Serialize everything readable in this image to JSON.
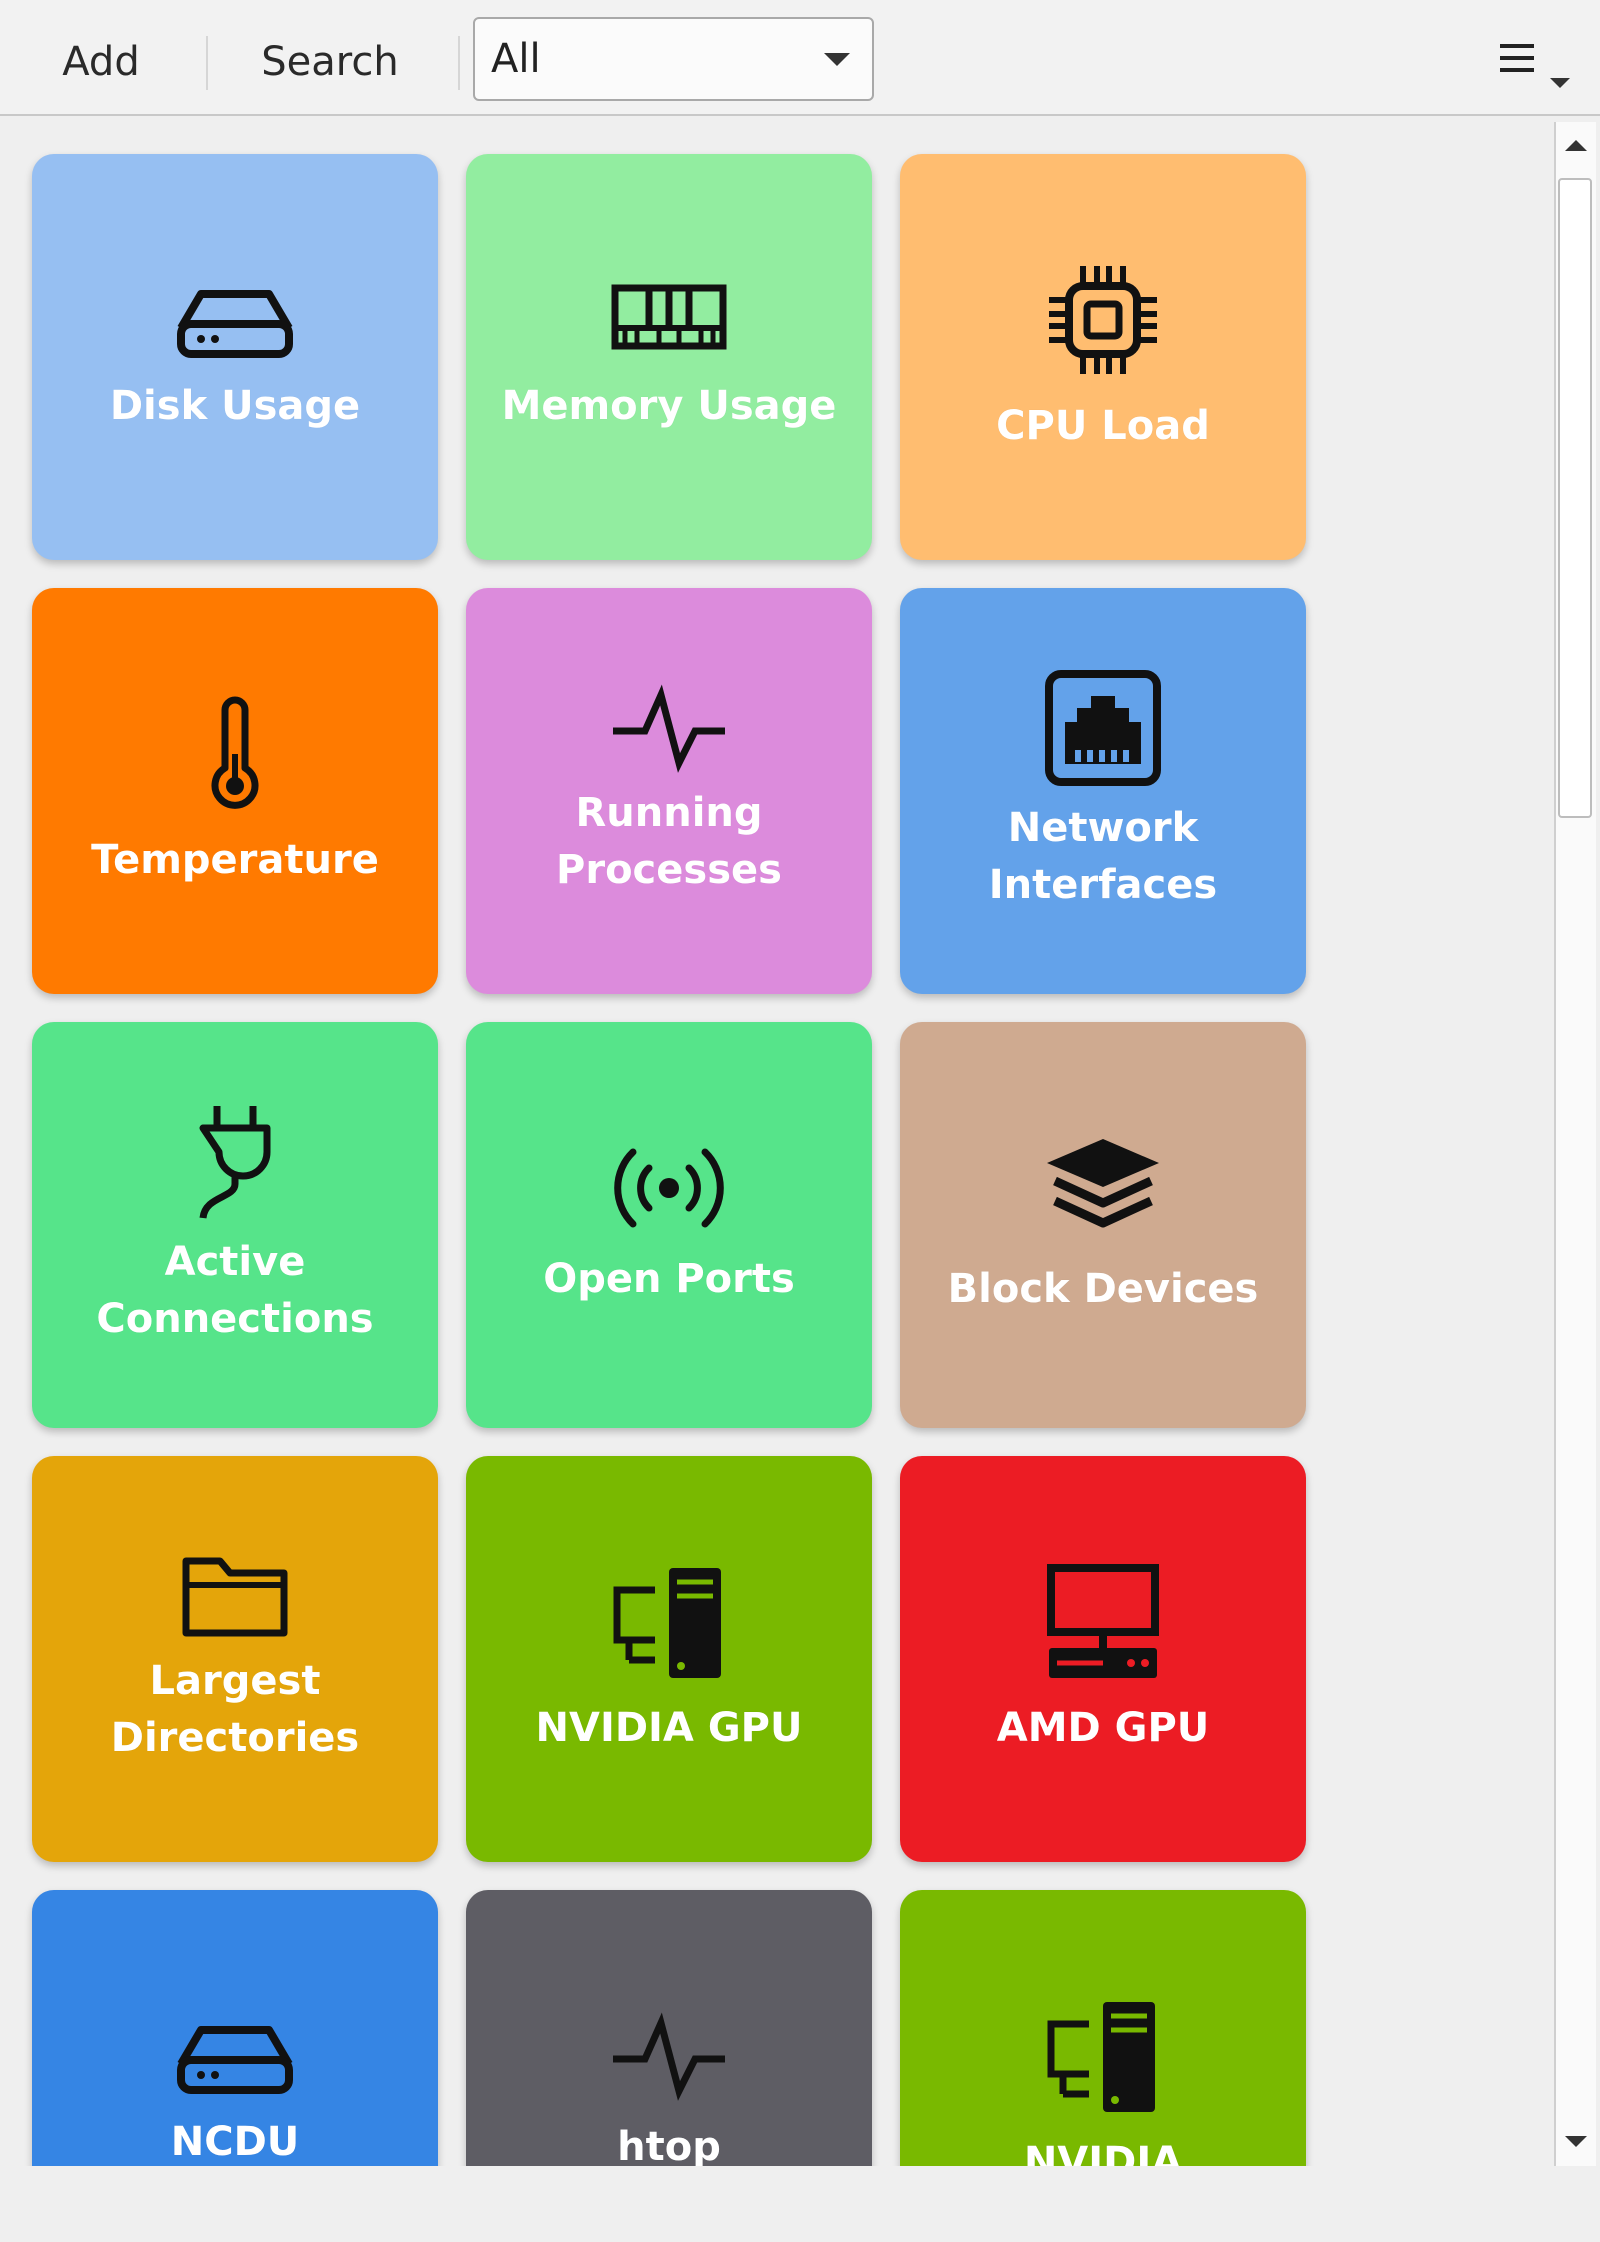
{
  "toolbar": {
    "add_label": "Add",
    "search_label": "Search",
    "filter_value": "All",
    "menu_icon": "hamburger-menu-icon"
  },
  "tiles": [
    {
      "label": "Disk Usage",
      "color": "#96bff2",
      "icon": "hard-drive-icon"
    },
    {
      "label": "Memory Usage",
      "color": "#92eda0",
      "icon": "memory-icon"
    },
    {
      "label": "CPU Load",
      "color": "#ffbd70",
      "icon": "cpu-icon"
    },
    {
      "label": "Temperature",
      "color": "#ff7a00",
      "icon": "thermometer-icon"
    },
    {
      "label": "Running Processes",
      "color": "#dc8bdc",
      "icon": "activity-icon"
    },
    {
      "label": "Network Interfaces",
      "color": "#63a2ea",
      "icon": "ethernet-port-icon"
    },
    {
      "label": "Active Connections",
      "color": "#56e48a",
      "icon": "plug-icon"
    },
    {
      "label": "Open Ports",
      "color": "#56e48a",
      "icon": "broadcast-icon"
    },
    {
      "label": "Block Devices",
      "color": "#cfaa90",
      "icon": "layers-icon"
    },
    {
      "label": "Largest Directories",
      "color": "#e4a50a",
      "icon": "folder-icon"
    },
    {
      "label": "NVIDIA GPU",
      "color": "#79b900",
      "icon": "computer-tower-icon"
    },
    {
      "label": "AMD GPU",
      "color": "#ec1c24",
      "icon": "desktop-computer-icon"
    },
    {
      "label": "NCDU",
      "color": "#3585e4",
      "icon": "hard-drive-icon"
    },
    {
      "label": "htop",
      "color": "#5e5d64",
      "icon": "activity-icon"
    },
    {
      "label": "NVIDIA",
      "color": "#79b900",
      "icon": "computer-tower-icon"
    }
  ]
}
